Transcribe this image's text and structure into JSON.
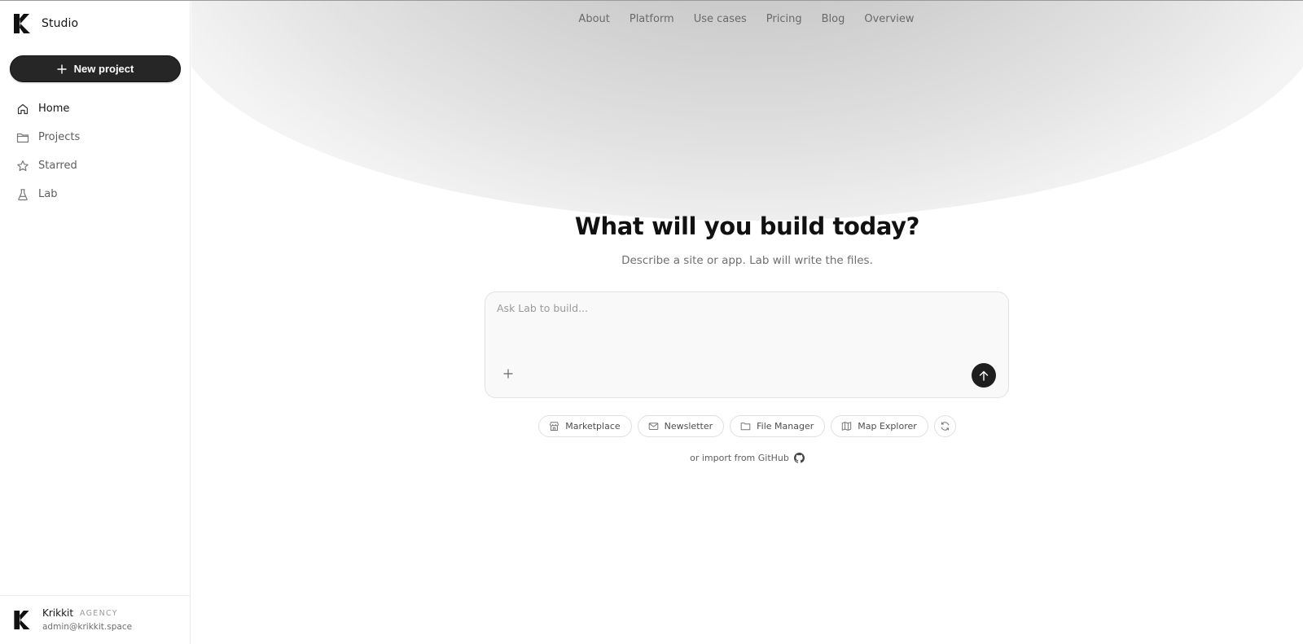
{
  "brand": {
    "name": "Studio"
  },
  "sidebar": {
    "new_project_label": "New project",
    "items": [
      {
        "label": "Home",
        "icon": "home-icon",
        "active": true
      },
      {
        "label": "Projects",
        "icon": "folder-icon",
        "active": false
      },
      {
        "label": "Starred",
        "icon": "star-icon",
        "active": false
      },
      {
        "label": "Lab",
        "icon": "flask-icon",
        "active": false
      }
    ]
  },
  "account": {
    "name": "Krikkit",
    "tag": "AGENCY",
    "email": "admin@krikkit.space"
  },
  "topnav": {
    "items": [
      "About",
      "Platform",
      "Use cases",
      "Pricing",
      "Blog",
      "Overview"
    ]
  },
  "hero": {
    "title": "What will you build today?",
    "subtitle": "Describe a site or app. Lab will write the files."
  },
  "prompt": {
    "placeholder": "Ask Lab to build..."
  },
  "suggestions": [
    {
      "label": "Marketplace",
      "icon": "store-icon"
    },
    {
      "label": "Newsletter",
      "icon": "mail-icon"
    },
    {
      "label": "File Manager",
      "icon": "folder-icon"
    },
    {
      "label": "Map Explorer",
      "icon": "map-icon"
    }
  ],
  "import": {
    "label": "or import from GitHub",
    "icon": "github-icon"
  },
  "colors": {
    "accent": "#262626",
    "glow": "#cfcfcf",
    "text_muted": "#6f6f6f"
  }
}
